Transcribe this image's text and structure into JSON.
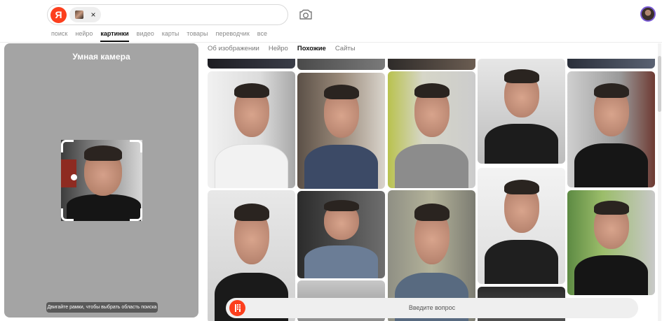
{
  "header": {
    "logo_letter": "Я",
    "search_chip_close": "×",
    "tabs": [
      {
        "label": "поиск"
      },
      {
        "label": "нейро"
      },
      {
        "label": "картинки"
      },
      {
        "label": "видео"
      },
      {
        "label": "карты"
      },
      {
        "label": "товары"
      },
      {
        "label": "переводчик"
      },
      {
        "label": "все"
      }
    ],
    "active_tab": "картинки"
  },
  "camera_panel": {
    "title": "Умная камера",
    "hint": "Двигайте рамки, чтобы выбрать область поиска"
  },
  "results": {
    "tabs": [
      {
        "label": "Об изображении"
      },
      {
        "label": "Нейро"
      },
      {
        "label": "Похожие"
      },
      {
        "label": "Сайты"
      }
    ],
    "active_tab": "Похожие"
  },
  "ask_bar": {
    "placeholder": "Введите вопрос"
  },
  "colors": {
    "brand": "#fc3f1d",
    "panel_bg": "#a4a4a4",
    "active_text": "#111111",
    "inactive_text": "#8a8a8a"
  }
}
